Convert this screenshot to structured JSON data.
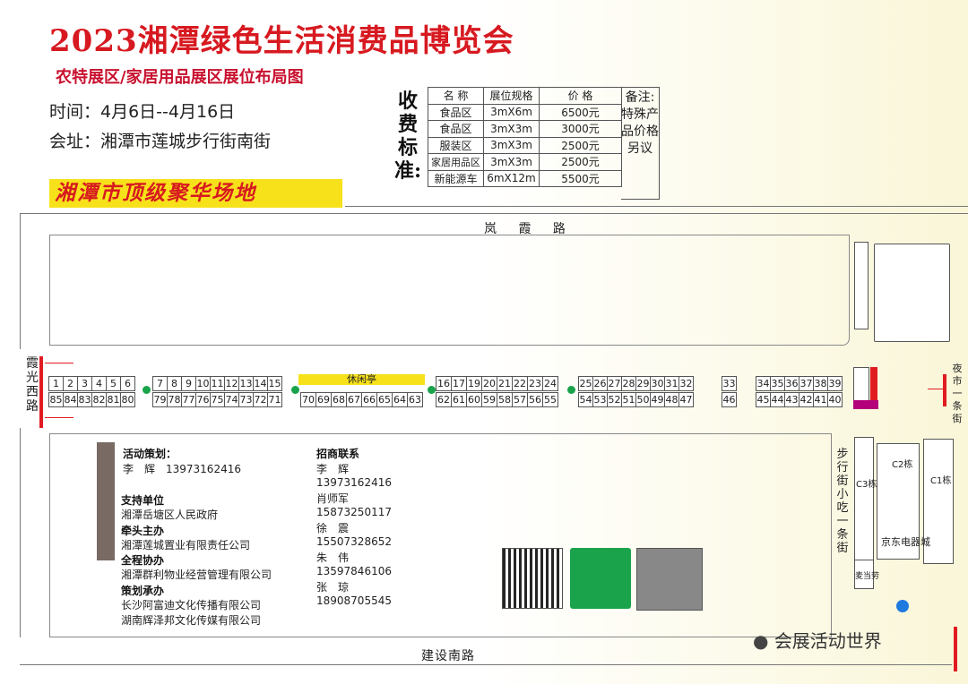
{
  "title": "2023湘潭绿色生活消费品博览会",
  "subtitle": "农特展区/家居用品展区展位布局图",
  "time": "时间：4月6日--4月16日",
  "venue": "会址：湘潭市莲城步行街南街",
  "slogan": "湘潭市顶级聚华场地",
  "fee": {
    "label": "收费标准:",
    "headers": [
      "名 称",
      "展位规格",
      "价 格"
    ],
    "rows": [
      [
        "食品区",
        "3mX6m",
        "6500元"
      ],
      [
        "食品区",
        "3mX3m",
        "3000元"
      ],
      [
        "服装区",
        "3mX3m",
        "2500元"
      ],
      [
        "家居用品区",
        "3mX3m",
        "2500元"
      ],
      [
        "新能源车",
        "6mX12m",
        "5500元"
      ]
    ],
    "note": "备注:特殊产品价格另议"
  },
  "roads": {
    "north": "岚 霞 路",
    "south": "建设南路",
    "west": "霞光西路",
    "east": "夜市一条街",
    "snack": "步行街小吃一条街"
  },
  "rest_area": "休闲亭",
  "booths_top_a": [
    "1",
    "2",
    "3",
    "4",
    "5",
    "6"
  ],
  "booths_top_b": [
    "7",
    "8",
    "9",
    "10",
    "11",
    "12",
    "13",
    "14",
    "15"
  ],
  "booths_top_c": [
    "16",
    "17",
    "19",
    "20",
    "21",
    "22",
    "23",
    "24"
  ],
  "booths_top_d": [
    "25",
    "26",
    "27",
    "28",
    "29",
    "30",
    "31",
    "32"
  ],
  "booths_top_e": [
    "33"
  ],
  "booths_top_f": [
    "34",
    "35",
    "36",
    "37",
    "38",
    "39"
  ],
  "booths_bot_a": [
    "85",
    "84",
    "83",
    "82",
    "81",
    "80"
  ],
  "booths_bot_b": [
    "79",
    "78",
    "77",
    "76",
    "75",
    "74",
    "73",
    "72",
    "71"
  ],
  "booths_bot_c": [
    "70",
    "69",
    "68",
    "67",
    "66",
    "65",
    "64",
    "63"
  ],
  "booths_bot_d": [
    "62",
    "61",
    "60",
    "59",
    "58",
    "57",
    "56",
    "55"
  ],
  "booths_bot_e": [
    "54",
    "53",
    "52",
    "51",
    "50",
    "49",
    "48",
    "47"
  ],
  "booths_bot_f": [
    "46"
  ],
  "booths_bot_g": [
    "45",
    "44",
    "43",
    "42",
    "41",
    "40"
  ],
  "buildings": {
    "c3": "C3栋",
    "c2": "C2栋",
    "c1": "C1栋",
    "jd": "京东电器城",
    "mx": "麦当劳"
  },
  "organizers": {
    "planning_h": "活动策划：",
    "planning_t": "李　辉　13973162416",
    "support_h": "支持单位",
    "support_t": "湘潭岳塘区人民政府",
    "lead_h": "牵头主办",
    "lead_t": "湘潭莲城置业有限责任公司",
    "assist_h": "全程协办",
    "assist_t": "湘潭群利物业经营管理有限公司",
    "exec_h": "策划承办",
    "exec_t1": "长沙阿富迪文化传播有限公司",
    "exec_t2": "湖南辉泽邦文化传媒有限公司"
  },
  "contacts": {
    "heading": "招商联系",
    "list": [
      "李　辉",
      "13973162416",
      "肖师军",
      "15873250117",
      "徐　震",
      "15507328652",
      "朱　伟",
      "13597846106",
      "张　琼",
      "18908705545"
    ]
  },
  "watermark": "会展活动世界"
}
